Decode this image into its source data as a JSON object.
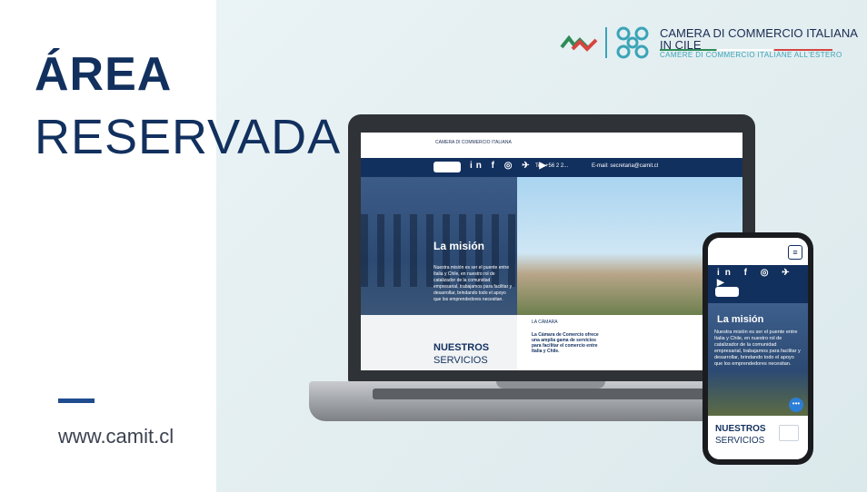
{
  "headline": {
    "line1": "ÁREA",
    "line2": "RESERVADA"
  },
  "website": "www.camit.cl",
  "logo": {
    "line1": "CAMERA DI COMMERCIO ITALIANA",
    "line2": "IN CILE",
    "line3": "CAMERE DI COMMERCIO ITALIANE ALL'ESTERO"
  },
  "laptop_site": {
    "logo_text": "CAMERA DI COMMERCIO ITALIANA",
    "social": "in f ◎ ✈ ▶",
    "tel": "Tel: +56 2 2...",
    "email": "E-mail: secretaria@camit.cl",
    "hero_title": "La misión",
    "hero_text": "Nuestra misión es ser el puente entre Italia y Chile, en nuestro rol de catalizador de la comunidad empresarial, trabajamos para facilitar y desarrollar, brindando todo el apoyo que los emprendedores necesitan.",
    "section_title_bold": "NUESTROS",
    "section_title": "SERVICIOS",
    "camara_label": "LA CÁMARA",
    "camara_text": "La Cámara de Comercio ofrece una amplia gama de servicios para facilitar el comercio entre Italia y Chile."
  },
  "phone_site": {
    "social": "in f ◎ ✈ ▶",
    "menu_icon": "≡",
    "hero_title": "La misión",
    "hero_text": "Nuestra misión es ser el puente entre Italia y Chile, en nuestro rol de catalizador de la comunidad empresarial, trabajamos para facilitar y desarrollar, brindando todo el apoyo que los emprendedores necesitan.",
    "chat_icon": "•••",
    "section_title_bold": "NUESTROS",
    "section_title": "SERVICIOS"
  },
  "colors": {
    "navy": "#12305e",
    "teal": "#3ba4b7",
    "background": "#e3eef0"
  }
}
